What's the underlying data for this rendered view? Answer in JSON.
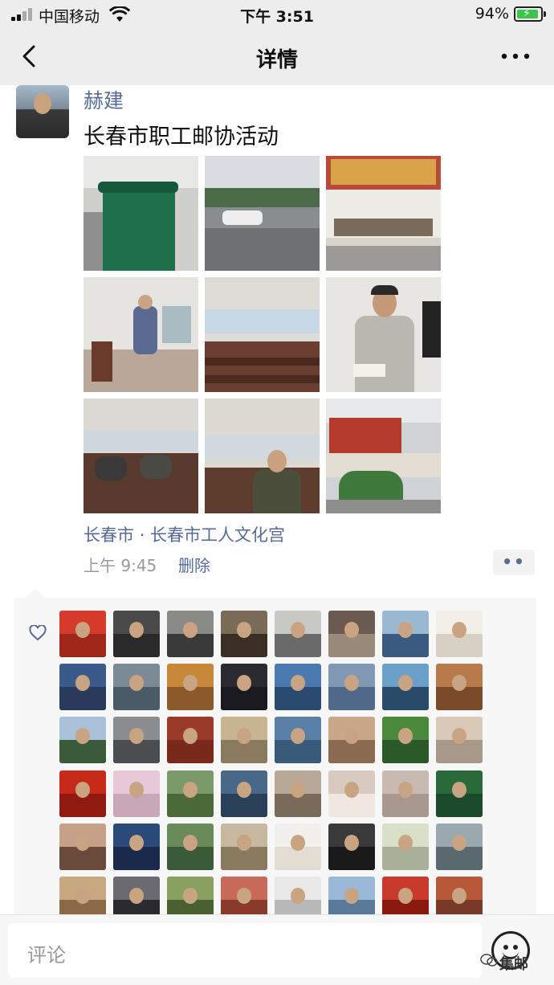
{
  "status_bar": {
    "carrier": "中国移动",
    "time": "下午 3:51",
    "battery_percent": "94%",
    "battery_level": 0.94,
    "charging": true
  },
  "nav": {
    "title": "详情",
    "back_icon": "back-chevron-icon",
    "more_icon": "more-dots-icon"
  },
  "post": {
    "author": "赫建",
    "text": "长春市职工邮协活动",
    "photo_count": 9,
    "location": "长春市 · 长春市工人文化宫",
    "time": "上午 9:45",
    "delete_label": "删除",
    "action_icon": "comment-like-dots-icon"
  },
  "likes": {
    "icon": "heart-icon",
    "liker_count": 48
  },
  "comment_bar": {
    "placeholder": "评论",
    "emoji_icon": "emoji-smile-icon"
  },
  "watermark": "集邮",
  "colors": {
    "link_blue": "#576b95",
    "bar_gray": "#ededed",
    "likes_bg": "#f7f7f7",
    "battery_green": "#3cc44c"
  }
}
